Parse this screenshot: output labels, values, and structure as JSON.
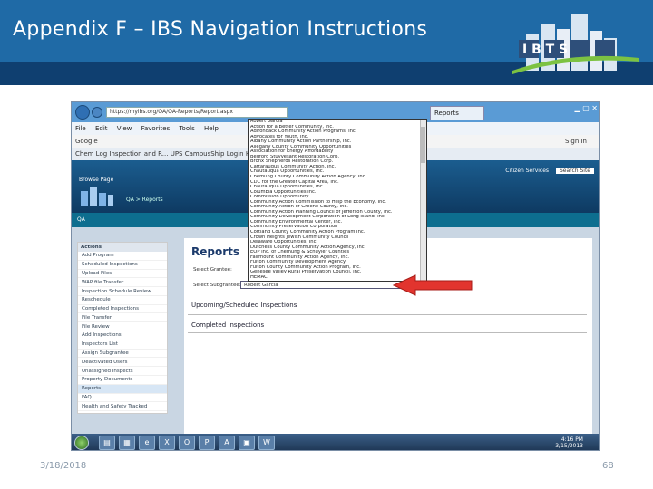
{
  "slide": {
    "title": "Appendix F – IBS Navigation Instructions",
    "logo_text": "I B T S",
    "date": "3/18/2018",
    "page_number": "68"
  },
  "browser": {
    "url": "https://myibs.org/QA/QA-Reports/Report.aspx",
    "tab_label": "Reports",
    "menu": [
      "File",
      "Edit",
      "View",
      "Favorites",
      "Tools",
      "Help"
    ],
    "google_label": "Google",
    "favorites_bar": "Chem Log Inspection and R...   UPS CampusShip Login   Home - IBTS Employee...",
    "sign_in": "Sign In"
  },
  "app": {
    "nav": "Browse   Page",
    "breadcrumb": "QA > Reports",
    "section": "QA",
    "right_text": "Citizen Services",
    "search_placeholder": "Search Site"
  },
  "sidebar": {
    "title": "Actions",
    "items": [
      "Add Program",
      "Scheduled Inspections",
      "Upload Files",
      "WAP file Transfer",
      "Inspection Schedule Review",
      "Reschedule",
      "Completed Inspections",
      "File Transfer",
      "File Review",
      "Add Inspections",
      "Inspectors List",
      "Assign Subgrantee",
      "Deactivated Users",
      "Unassigned Inspects",
      "Property Documents",
      "Reports",
      "FAQ",
      "Health and Safety Tracked"
    ]
  },
  "reports": {
    "title": "Reports",
    "grantee_label": "Select Grantee:",
    "subgrantee_label": "Select Subgrantee:",
    "subgrantee_value": "Robert Garcia",
    "upcoming": "Upcoming/Scheduled Inspections",
    "completed": "Completed Inspections"
  },
  "dropdown": {
    "items": [
      "Robert Garcia",
      "Action for a Better Community, Inc.",
      "Adirondack Community Action Programs, Inc.",
      "Advocates for Youth, Inc.",
      "Albany Community Action Partnership, Inc.",
      "Allegany County Community Opportunities",
      "Association for Energy Affordability",
      "Bedford Stuyvesant Restoration Corp.",
      "Bronx Shepherds Restoration Corp.",
      "Cattaraugus Community Action, Inc.",
      "Chautauqua Opportunities, Inc.",
      "Chemung County Community Action Agency, Inc.",
      "CDC for the Greater Capital Area, Inc.",
      "Chautauqua Opportunities, Inc.",
      "Columbia Opportunities Inc.",
      "Commission Opportunity",
      "Community Action Commission to Help the Economy, Inc.",
      "Community Action of Greene County, Inc.",
      "Community Action Planning Council of Jefferson County, Inc.",
      "Community Development Corporation of Long Island, Inc.",
      "Community Environmental Center, Inc.",
      "Community Preservation Corporation",
      "Cortland County Community Action Program Inc.",
      "Crown Heights Jewish Community Council",
      "Delaware Opportunities, Inc.",
      "Dutchess County Community Action Agency, Inc.",
      "EOP Inc. of Chemung & Schuyler Counties",
      "Fairmount Community Action Agency, Inc.",
      "Fulton Community Development Agency",
      "Fulton County Community Action Program, Inc.",
      "Genesee Valley Rural Preservation Council, Inc.",
      "HEMAC"
    ]
  },
  "taskbar": {
    "time": "4:16 PM",
    "date": "3/15/2013"
  }
}
